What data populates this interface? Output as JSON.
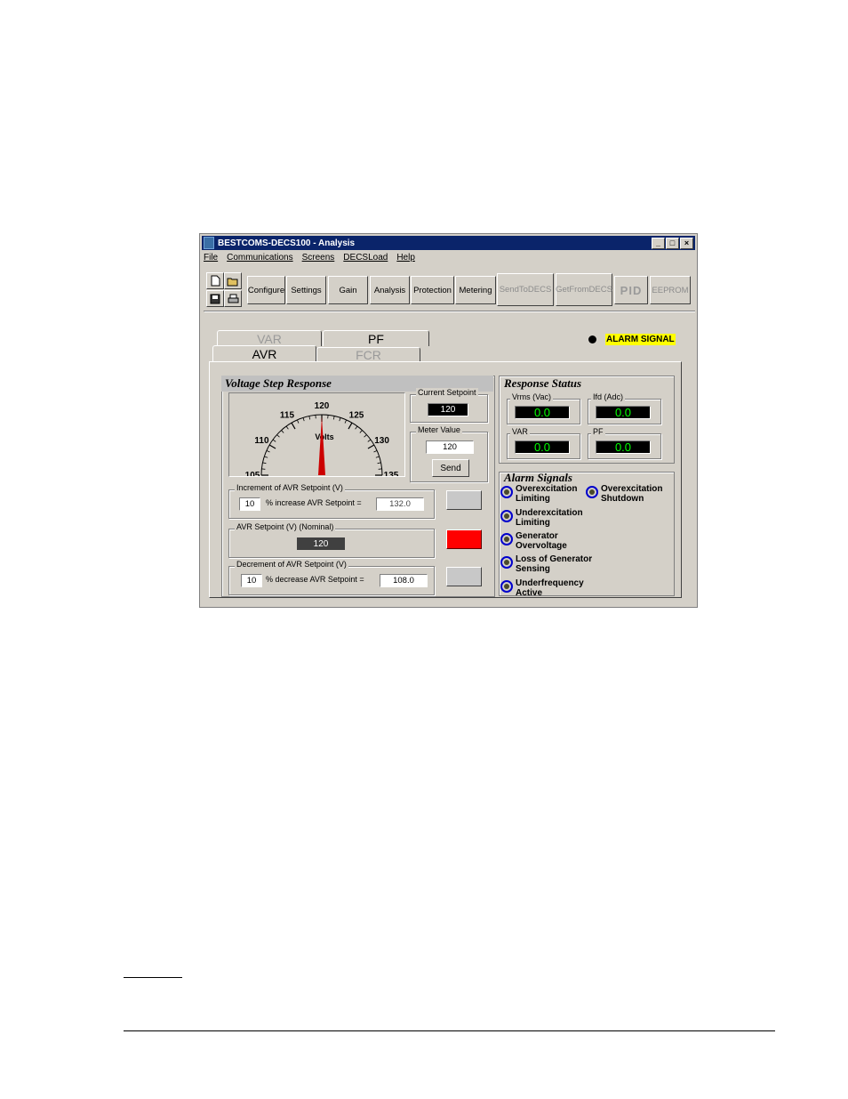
{
  "window": {
    "title": "BESTCOMS-DECS100 - Analysis",
    "controls": {
      "minimize": "_",
      "maximize": "□",
      "close": "×"
    }
  },
  "menu": [
    "File",
    "Communications",
    "Screens",
    "DECSLoad",
    "Help"
  ],
  "toolbar": {
    "icons": [
      "new-file-icon",
      "open-folder-icon",
      "save-icon",
      "print-icon"
    ],
    "buttons": [
      {
        "label": "Configure",
        "enabled": true
      },
      {
        "label": "Settings",
        "enabled": true
      },
      {
        "label": "Gain",
        "enabled": true
      },
      {
        "label": "Analysis",
        "enabled": true
      },
      {
        "label": "Protection",
        "enabled": true
      },
      {
        "label": "Metering",
        "enabled": true
      },
      {
        "label": "SendToDECS",
        "enabled": false
      },
      {
        "label": "GetFromDECS",
        "enabled": false
      },
      {
        "label": "PID",
        "enabled": false
      },
      {
        "label": "EEPROM",
        "enabled": false
      }
    ]
  },
  "tabs": {
    "back": [
      "VAR",
      "PF"
    ],
    "front": [
      "AVR",
      "FCR"
    ],
    "active": "AVR"
  },
  "alarm_indicator": {
    "label": "ALARM SIGNAL",
    "color": "#ffff00"
  },
  "voltage_step": {
    "title": "Voltage Step Response",
    "gauge": {
      "ticks": [
        "105",
        "110",
        "115",
        "120",
        "125",
        "130",
        "135"
      ],
      "unit": "Volts",
      "needle_value": 120,
      "needle_color": "#cc0000"
    },
    "current_setpoint": {
      "label": "Current Setpoint",
      "value": "120"
    },
    "meter_value": {
      "label": "Meter Value",
      "value": "120",
      "send_label": "Send"
    },
    "increment": {
      "label": "Increment of AVR Setpoint (V)",
      "percent": "10",
      "text": "% increase  AVR Setpoint =",
      "result": "132.0"
    },
    "nominal": {
      "label": "AVR Setpoint (V) (Nominal)",
      "value": "120"
    },
    "decrement": {
      "label": "Decrement of AVR Setpoint (V)",
      "percent": "10",
      "text": "% decrease  AVR Setpoint =",
      "result": "108.0"
    },
    "step_buttons": {
      "colors": [
        "#d4d0c8",
        "#ff0000",
        "#d4d0c8"
      ]
    }
  },
  "response_status": {
    "title": "Response Status",
    "meters": [
      {
        "label": "Vrms (Vac)",
        "value": "0.0"
      },
      {
        "label": "Ifd (Adc)",
        "value": "0.0"
      },
      {
        "label": "VAR",
        "value": "0.0"
      },
      {
        "label": "PF",
        "value": "0.0"
      }
    ],
    "value_color": "#00ff00"
  },
  "alarm_signals": {
    "title": "Alarm Signals",
    "items": [
      {
        "line1": "Overexcitation",
        "line2": "Limiting"
      },
      {
        "line1": "Overexcitation",
        "line2": "Shutdown"
      },
      {
        "line1": "Underexcitation",
        "line2": "Limiting"
      },
      {
        "line1": "Generator",
        "line2": "Overvoltage"
      },
      {
        "line1": "Loss of Generator",
        "line2": "Sensing"
      },
      {
        "line1": "Underfrequency",
        "line2": "Active"
      }
    ]
  }
}
